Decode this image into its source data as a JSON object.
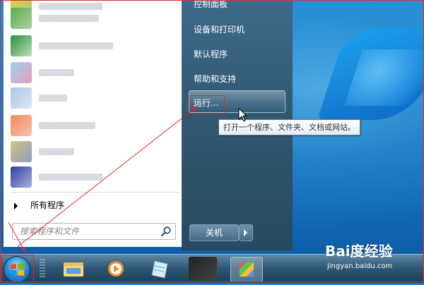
{
  "start_menu": {
    "left_pane": {
      "all_programs_label": "所有程序",
      "search_placeholder": "搜索程序和文件"
    },
    "right_pane": {
      "items": [
        {
          "label": "控制面板"
        },
        {
          "label": "设备和打印机"
        },
        {
          "label": "默认程序"
        },
        {
          "label": "帮助和支持"
        }
      ],
      "run_label": "运行...",
      "shutdown_label": "关机"
    }
  },
  "tooltip": {
    "text": "打开一个程序、文件夹、文档或网站。"
  },
  "watermark": {
    "logo": "Bai度经验",
    "url": "jingyan.baidu.com"
  },
  "icons": [
    "windows-start-orb",
    "search-icon",
    "explorer-icon",
    "media-player-icon",
    "notepad-icon",
    "mouse-pointer-icon"
  ],
  "colors": {
    "highlight_annotation": "#e02828",
    "taskbar": "#2f5877",
    "menu_right_pane": "#30576f"
  }
}
